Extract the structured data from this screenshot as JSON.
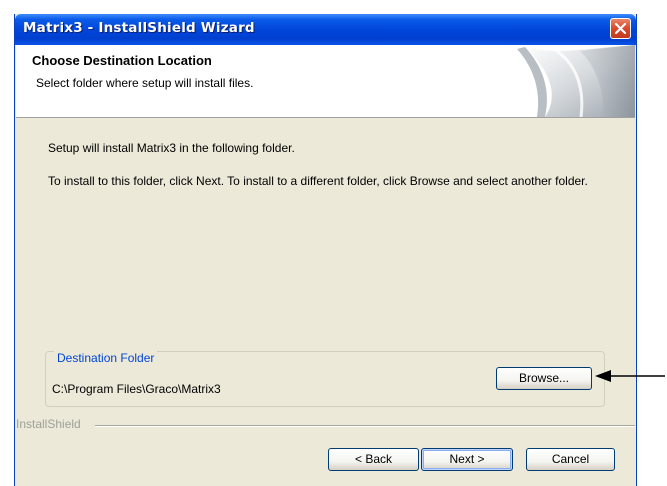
{
  "window": {
    "title": "Matrix3 - InstallShield Wizard"
  },
  "header": {
    "title": "Choose Destination Location",
    "subtitle": "Select folder where setup will install files."
  },
  "body": {
    "line1": "Setup will install Matrix3 in the following folder.",
    "line2": "To install to this folder, click Next. To install to a different folder, click Browse and select another folder."
  },
  "destination": {
    "label": "Destination Folder",
    "path": "C:\\Program Files\\Graco\\Matrix3",
    "browse_label": "Browse..."
  },
  "footer": {
    "brand": "InstallShield",
    "back_label": "< Back",
    "next_label": "Next >",
    "cancel_label": "Cancel"
  },
  "icons": {
    "close": "close-icon",
    "annotation_arrow": "left-arrow-icon"
  },
  "colors": {
    "titlebar": "#0a54e8",
    "close_button": "#d9482b",
    "dialog_background": "#ece9d8",
    "group_label": "#0046d5"
  }
}
